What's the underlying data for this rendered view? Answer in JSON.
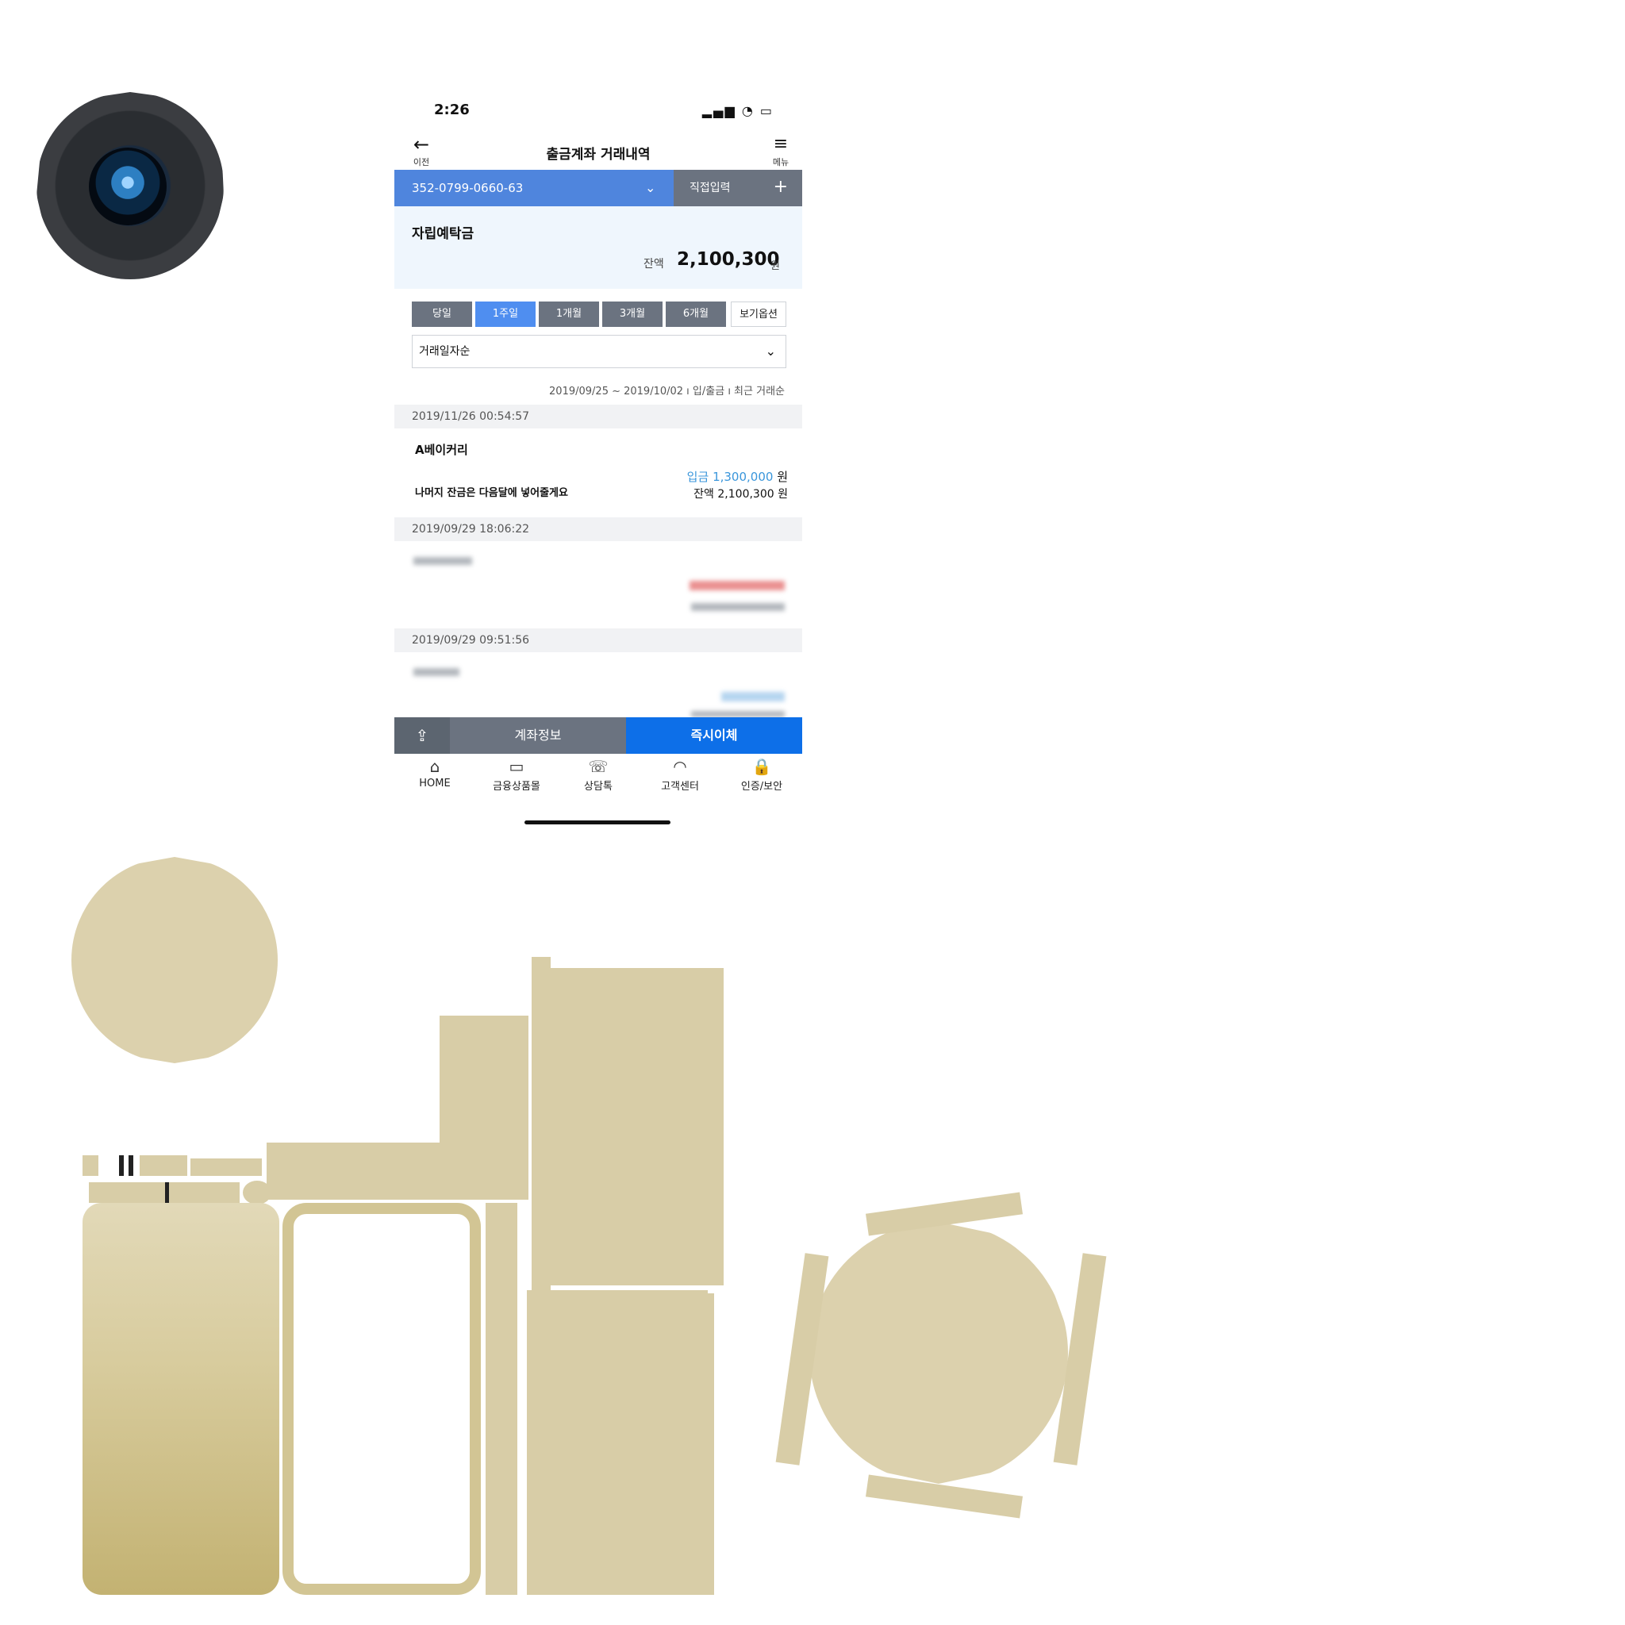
{
  "status_bar": {
    "time": "2:26",
    "icons": "▂▄▆ ◔ ▭"
  },
  "nav": {
    "back_icon": "←",
    "back_label": "이전",
    "title": "출금계좌 거래내역",
    "menu_icon": "≡",
    "menu_label": "메뉴"
  },
  "account": {
    "number": "352-0799-0660-63",
    "chevron": "⌄",
    "direct_input": "직접입력",
    "plus": "+"
  },
  "summary": {
    "product": "자립예탁금",
    "balance_label": "잔액",
    "balance": "2,100,300",
    "unit": "원"
  },
  "periods": [
    {
      "label": "당일",
      "active": false
    },
    {
      "label": "1주일",
      "active": true
    },
    {
      "label": "1개월",
      "active": false
    },
    {
      "label": "3개월",
      "active": false
    },
    {
      "label": "6개월",
      "active": false
    }
  ],
  "view_options": "보기옵션",
  "sort": {
    "value": "거래일자순",
    "chevron": "⌄"
  },
  "filter_info": "2019/09/25 ~ 2019/10/02 ı 입/출금 ı 최근 거래순",
  "transactions": [
    {
      "datetime": "2019/11/26 00:54:57",
      "name": "A베이커리",
      "memo": "나머지 잔금은 다음달에 넣어줄게요",
      "amount_label": "입금",
      "amount": "1,300,000",
      "unit": "원",
      "balance_label": "잔액",
      "balance": "2,100,300"
    },
    {
      "datetime": "2019/09/29 18:06:22",
      "name": "",
      "memo": "",
      "amount_label": "",
      "amount": "",
      "unit": "",
      "balance_label": "",
      "balance": ""
    },
    {
      "datetime": "2019/09/29 09:51:56",
      "name": "",
      "memo": "",
      "amount_label": "",
      "amount": "",
      "unit": "",
      "balance_label": "",
      "balance": ""
    }
  ],
  "actions": {
    "share_icon": "⇪",
    "account_info": "계좌정보",
    "transfer": "즉시이체"
  },
  "tabs": [
    {
      "icon": "⌂",
      "label": "HOME"
    },
    {
      "icon": "▭",
      "label": "금융상품몰"
    },
    {
      "icon": "☏",
      "label": "상담톡"
    },
    {
      "icon": "◠",
      "label": "고객센터"
    },
    {
      "icon": "🔒",
      "label": "인증/보안"
    }
  ],
  "texture": {
    "apple_logo": ""
  },
  "colors": {
    "primary": "#0d6fe8",
    "account_bar": "#4f85dd",
    "gray_button": "#6b7380",
    "deposit": "#3a96db",
    "gold": "#dcd1ad"
  }
}
